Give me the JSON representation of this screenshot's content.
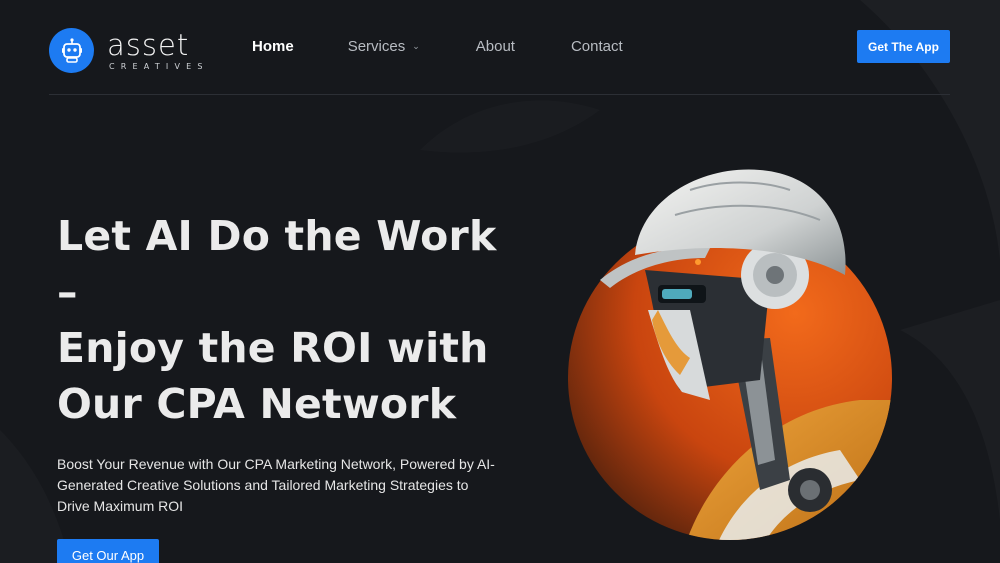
{
  "brand": {
    "name": "asset",
    "tagline": "CREATIVES",
    "accent": "#1d7bf2",
    "background": "#16181c"
  },
  "nav": {
    "items": [
      {
        "label": "Home",
        "active": true
      },
      {
        "label": "Services",
        "has_dropdown": true,
        "icon": "chevron-down-icon"
      },
      {
        "label": "About"
      },
      {
        "label": "Contact"
      }
    ],
    "cta_label": "Get The App"
  },
  "hero": {
    "heading_line1": "Let AI Do the Work –",
    "heading_line2": "Enjoy the ROI with",
    "heading_line3": "Our CPA Network",
    "description": "Boost Your Revenue with Our CPA Marketing Network, Powered by AI-Generated Creative Solutions and Tailored Marketing Strategies to Drive Maximum ROI",
    "cta_label": "Get Our App",
    "image_icon": "robot-hardhat-illustration",
    "circle_color": "#e8621a"
  }
}
